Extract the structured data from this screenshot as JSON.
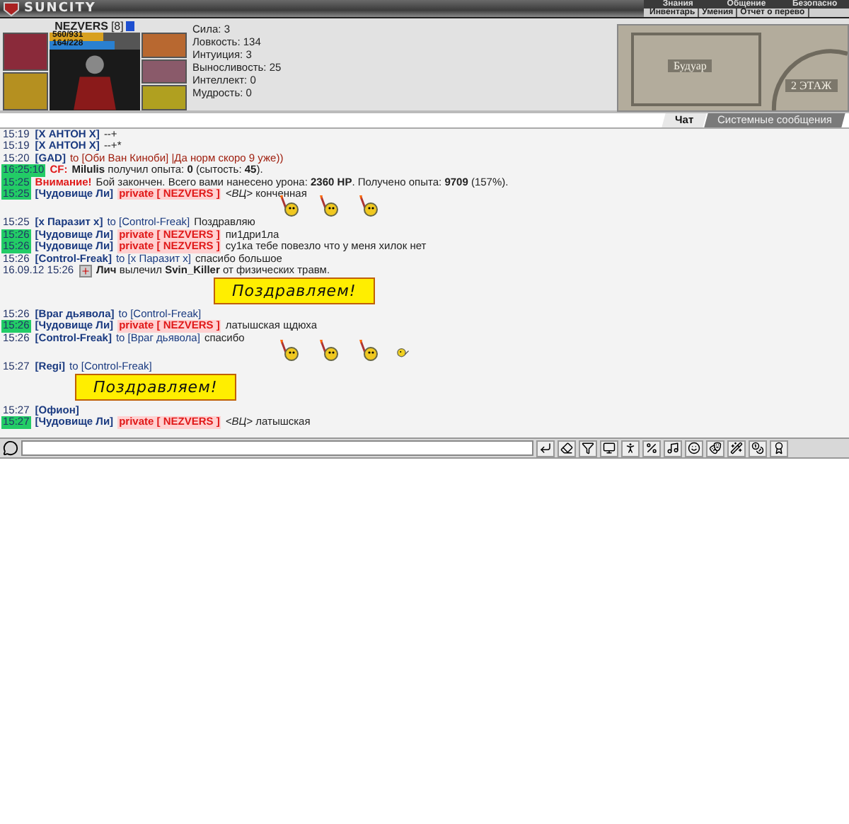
{
  "header": {
    "logo": "SUNCITY",
    "menu": [
      "Знания",
      "Общение",
      "Безопасно"
    ],
    "submenu": [
      "Инвентарь",
      "Умения",
      "Отчет о перево"
    ]
  },
  "character": {
    "name": "NEZVERS",
    "level": "[8]",
    "hp": {
      "text": "560/931",
      "level": 0.6
    },
    "mana": {
      "text": "164/228",
      "level": 0.72
    },
    "stats": [
      "Сила: 3",
      "Ловкость: 134",
      "Интуиция: 3",
      "Выносливость: 25",
      "Интеллект: 0",
      "Мудрость: 0"
    ]
  },
  "map": {
    "room": "Будуар",
    "floor": "2 ЭТАЖ"
  },
  "tabs": [
    {
      "label": "Чат",
      "selected": true
    },
    {
      "label": "Системные сообщения",
      "selected": false
    }
  ],
  "messages": [
    {
      "kind": "line",
      "time": "15:19",
      "private": false,
      "parts": [
        {
          "kind": "nick",
          "text": "[X АНТОН X]"
        },
        {
          "kind": "text",
          "text": "--+"
        }
      ]
    },
    {
      "kind": "line",
      "time": "15:19",
      "private": false,
      "parts": [
        {
          "kind": "nick",
          "text": "[X АНТОН X]"
        },
        {
          "kind": "text",
          "text": "--+*"
        }
      ]
    },
    {
      "kind": "line",
      "time": "15:20",
      "private": false,
      "parts": [
        {
          "kind": "nick",
          "text": "[GAD]"
        },
        {
          "kind": "to_other",
          "text": "to [Оби Ван Киноби] |Да норм скоро 9 уже))"
        }
      ]
    },
    {
      "kind": "line",
      "time": "16:25:10",
      "private": true,
      "parts": [
        {
          "kind": "alert",
          "text": "CF:"
        },
        {
          "kind": "text",
          "text": "**Milulis** получил опыта: **0** (сытость: **45**)."
        }
      ]
    },
    {
      "kind": "line",
      "time": "15:25",
      "private": true,
      "parts": [
        {
          "kind": "alert",
          "text": "Внимание!"
        },
        {
          "kind": "text",
          "text": "Бой закончен. Всего вами нанесено урона: **2360 HP**. Получено опыта: **9709** (157%)."
        }
      ]
    },
    {
      "kind": "line",
      "time": "15:25",
      "private": true,
      "parts": [
        {
          "kind": "nick",
          "text": "[Чудовище Ли]"
        },
        {
          "kind": "private",
          "text": "private [ NEZVERS ]"
        },
        {
          "kind": "text",
          "text": "*<ВЦ>* конченная"
        }
      ]
    },
    {
      "kind": "smileys",
      "items": [
        {
          "kind": "flag"
        },
        {
          "kind": "flag"
        },
        {
          "kind": "flag"
        }
      ]
    },
    {
      "kind": "line",
      "time": "15:25",
      "private": false,
      "parts": [
        {
          "kind": "nick",
          "text": "[x Паразит x]"
        },
        {
          "kind": "to",
          "text": "to [Control-Freak]"
        },
        {
          "kind": "text",
          "text": "Поздравляю"
        }
      ]
    },
    {
      "kind": "line",
      "time": "15:26",
      "private": true,
      "parts": [
        {
          "kind": "nick",
          "text": "[Чудовище Ли]"
        },
        {
          "kind": "private",
          "text": "private [ NEZVERS ]"
        },
        {
          "kind": "text",
          "text": "пи1дри1ла"
        }
      ]
    },
    {
      "kind": "line",
      "time": "15:26",
      "private": true,
      "parts": [
        {
          "kind": "nick",
          "text": "[Чудовище Ли]"
        },
        {
          "kind": "private",
          "text": "private [ NEZVERS ]"
        },
        {
          "kind": "text",
          "text": "су1ка тебе повезло что у меня хилок нет"
        }
      ]
    },
    {
      "kind": "line",
      "time": "15:26",
      "private": false,
      "parts": [
        {
          "kind": "nick",
          "text": "[Control-Freak]"
        },
        {
          "kind": "to",
          "text": "to [x Паразит x]"
        },
        {
          "kind": "text",
          "text": "спасибо большое"
        }
      ]
    },
    {
      "kind": "line",
      "time": "16.09.12 15:26",
      "private": false,
      "parts": [
        {
          "kind": "heal"
        },
        {
          "kind": "text",
          "text": "**Лич** вылечил **Svin_Killer** от физических травм."
        }
      ]
    },
    {
      "kind": "banner",
      "text": "Поздравляем!"
    },
    {
      "kind": "line",
      "time": "15:26",
      "private": false,
      "parts": [
        {
          "kind": "nick",
          "text": "[Враг дьявола]"
        },
        {
          "kind": "to",
          "text": "to [Control-Freak]"
        }
      ]
    },
    {
      "kind": "line",
      "time": "15:26",
      "private": true,
      "parts": [
        {
          "kind": "nick",
          "text": "[Чудовище Ли]"
        },
        {
          "kind": "private",
          "text": "private [ NEZVERS ]"
        },
        {
          "kind": "text",
          "text": "латышская щдюха"
        }
      ]
    },
    {
      "kind": "line",
      "time": "15:26",
      "private": false,
      "parts": [
        {
          "kind": "nick",
          "text": "[Control-Freak]"
        },
        {
          "kind": "to",
          "text": "to [Враг дьявола]"
        },
        {
          "kind": "text",
          "text": "спасибо"
        }
      ]
    },
    {
      "kind": "smileys",
      "items": [
        {
          "kind": "flag"
        },
        {
          "kind": "flag"
        },
        {
          "kind": "flag"
        },
        {
          "kind": "face"
        }
      ]
    },
    {
      "kind": "line",
      "time": "15:27",
      "private": false,
      "parts": [
        {
          "kind": "nick",
          "text": "[Regi]"
        },
        {
          "kind": "to",
          "text": "to [Control-Freak]"
        }
      ]
    },
    {
      "kind": "banner",
      "text": "Поздравляем!"
    },
    {
      "kind": "line",
      "time": "15:27",
      "private": false,
      "parts": [
        {
          "kind": "nick",
          "text": "[Офион]"
        }
      ]
    },
    {
      "kind": "line",
      "time": "15:27",
      "private": true,
      "parts": [
        {
          "kind": "nick",
          "text": "[Чудовище Ли]"
        },
        {
          "kind": "private",
          "text": "private [ NEZVERS ]"
        },
        {
          "kind": "text",
          "text": "*<ВЦ>* латышская"
        }
      ]
    }
  ]
}
